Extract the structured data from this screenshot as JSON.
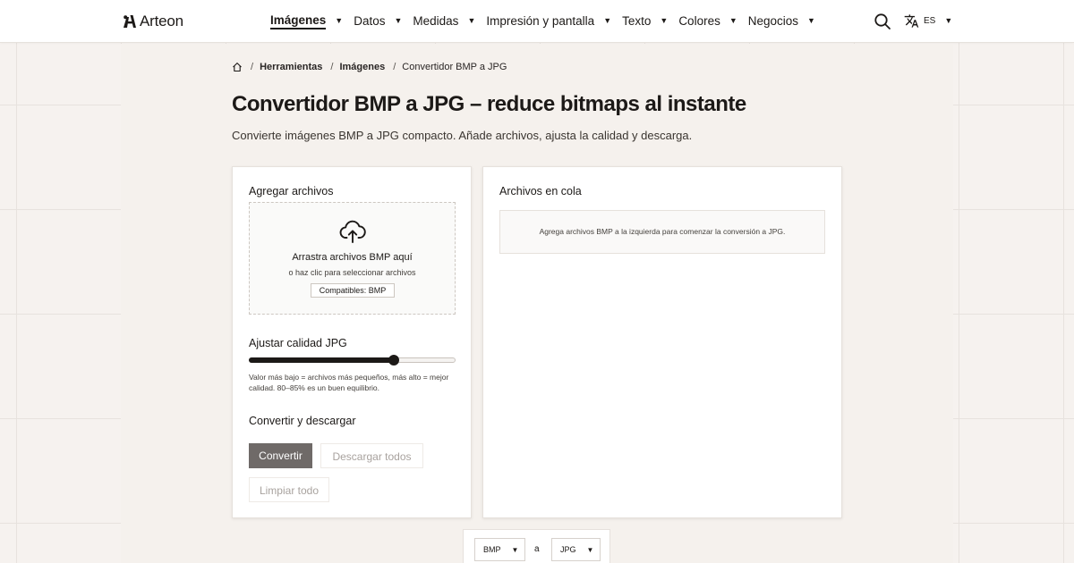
{
  "header": {
    "logo_text": "Arteon",
    "nav": [
      {
        "label": "Imágenes",
        "active": true
      },
      {
        "label": "Datos"
      },
      {
        "label": "Medidas"
      },
      {
        "label": "Impresión y pantalla"
      },
      {
        "label": "Texto"
      },
      {
        "label": "Colores"
      },
      {
        "label": "Negocios"
      }
    ],
    "caret": "▼",
    "lang_code": "ES"
  },
  "breadcrumb": {
    "sep": "/",
    "items": [
      "Herramientas",
      "Imágenes"
    ],
    "current": "Convertidor BMP a JPG"
  },
  "page": {
    "title": "Convertidor BMP a JPG – reduce bitmaps al instante",
    "subtitle": "Convierte imágenes BMP a JPG compacto. Añade archivos, ajusta la calidad y descarga."
  },
  "upload": {
    "title": "Agregar archivos",
    "drop_title": "Arrastra archivos BMP aquí",
    "drop_sub": "o haz clic para seleccionar archivos",
    "badge": "Compatibles: BMP"
  },
  "quality": {
    "title": "Ajustar calidad JPG",
    "value": 0.7,
    "hint": "Valor más bajo = archivos más pequeños, más alto = mejor calidad. 80–85% es un buen equilibrio."
  },
  "convert": {
    "title": "Convertir y descargar",
    "convert_label": "Convertir",
    "download_label": "Descargar todos",
    "clear_label": "Limpiar todo"
  },
  "queue": {
    "title": "Archivos en cola",
    "empty": "Agrega archivos BMP a la izquierda para comenzar la conversión a JPG."
  },
  "format": {
    "from": "BMP",
    "connector": "a",
    "to": "JPG"
  },
  "colors": {
    "primary_button": "#6f6a68",
    "text": "#1c1917",
    "background": "#f6f2ef"
  }
}
